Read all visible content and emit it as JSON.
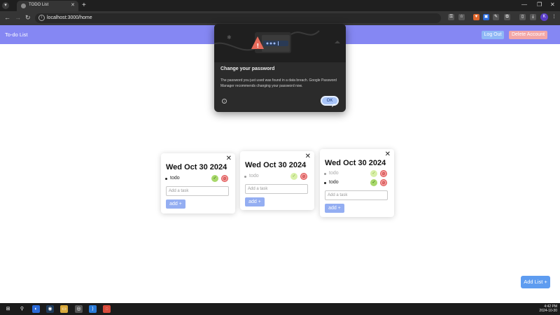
{
  "browser": {
    "tab_title": "TODO List",
    "url": "localhost:3000/home",
    "profile_initial": "K"
  },
  "navbar": {
    "app_title": "To-do List",
    "logout_label": "Log Out",
    "delete_account_label": "Delete Account"
  },
  "lists": [
    {
      "date": "Wed Oct 30 2024",
      "tasks": [
        {
          "text": "todo",
          "done": false
        }
      ],
      "input_placeholder": "Add a task",
      "add_label": "add"
    },
    {
      "date": "Wed Oct 30 2024",
      "tasks": [
        {
          "text": "todo",
          "done": true
        }
      ],
      "input_placeholder": "Add a task",
      "add_label": "add"
    },
    {
      "date": "Wed Oct 30 2024",
      "tasks": [
        {
          "text": "todo",
          "done": true
        },
        {
          "text": "todo",
          "done": false
        }
      ],
      "input_placeholder": "Add a task",
      "add_label": "add"
    }
  ],
  "add_list_label": "Add List",
  "dialog": {
    "title": "Change your password",
    "body": "The password you just used was found in a data breach. Google Password Manager recommends changing your password now.",
    "ok_label": "OK"
  },
  "taskbar": {
    "time": "4:42 PM",
    "date": "2024-10-30"
  },
  "colors": {
    "navbar": "#8587f3",
    "logout": "#8fb8f6",
    "delete_account": "#f3a7a7",
    "add_button": "#94aef2",
    "add_list": "#5e9cf0"
  }
}
